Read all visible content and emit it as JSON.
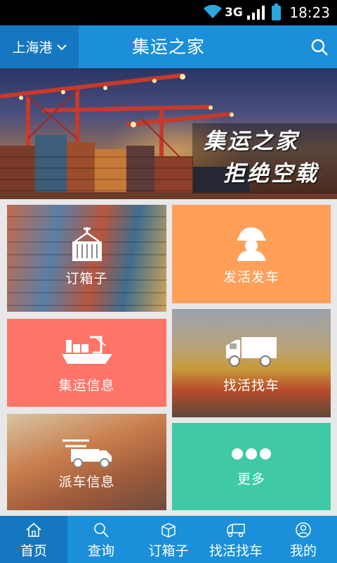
{
  "status_bar": {
    "network": "3G",
    "time": "18:23"
  },
  "header": {
    "city": "上海港",
    "title": "集运之家"
  },
  "banner": {
    "line1": "集运之家",
    "line2": "拒绝空载"
  },
  "tiles": {
    "order_box": {
      "label": "订箱子",
      "icon": "container-crane-icon"
    },
    "post_job": {
      "label": "发活发车",
      "icon": "worker-icon"
    },
    "shipping_info": {
      "label": "集运信息",
      "icon": "ship-icon"
    },
    "find_job": {
      "label": "找活找车",
      "icon": "truck-icon"
    },
    "dispatch_info": {
      "label": "派车信息",
      "icon": "fast-truck-icon"
    },
    "more": {
      "label": "更多",
      "icon": "more-dots-icon"
    }
  },
  "bottom_nav": [
    {
      "label": "首页",
      "icon": "home-icon",
      "active": true
    },
    {
      "label": "查询",
      "icon": "search-icon",
      "active": false
    },
    {
      "label": "订箱子",
      "icon": "box-icon",
      "active": false
    },
    {
      "label": "找活找车",
      "icon": "truck-icon",
      "active": false
    },
    {
      "label": "我的",
      "icon": "user-icon",
      "active": false
    }
  ],
  "colors": {
    "header_blue": "#1b8fd9",
    "header_dark_blue": "#1577c0",
    "orange": "#ff9f58",
    "coral": "#ff7468",
    "teal": "#3fc9a5"
  }
}
